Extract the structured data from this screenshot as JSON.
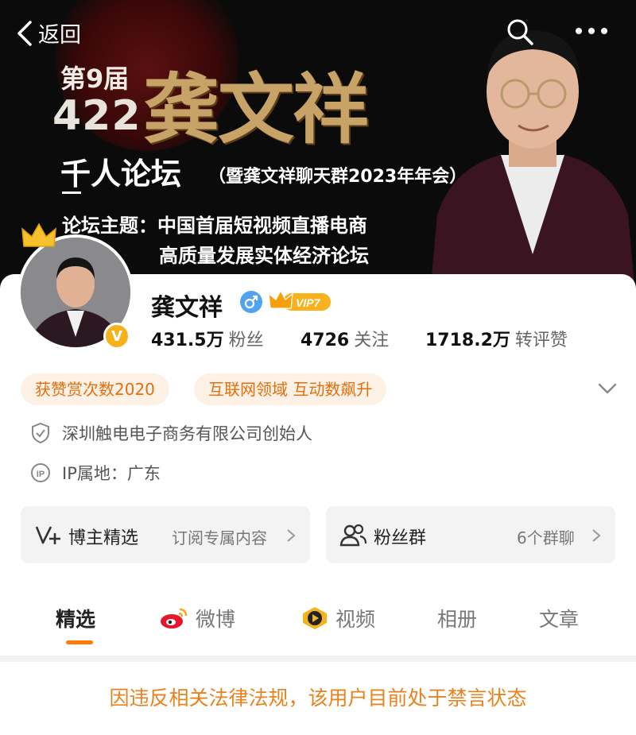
{
  "topbar": {
    "back_label": "返回"
  },
  "banner": {
    "edition": "第9届",
    "number": "422",
    "name": "龚文祥",
    "forum_title": "千人论坛",
    "forum_subtitle": "（暨龚文祥聊天群2023年年会）",
    "theme_line1": "论坛主题：中国首届短视频直播电商",
    "theme_line2": "高质量发展实体经济论坛"
  },
  "profile": {
    "name": "龚文祥",
    "vip_label": "VIP7",
    "verified_mark": "V",
    "stats": [
      {
        "value": "431.5万",
        "label": "粉丝"
      },
      {
        "value": "4726",
        "label": "关注"
      },
      {
        "value": "1718.2万",
        "label": "转评赞"
      }
    ],
    "tags": [
      "获赞赏次数2020",
      "互联网领域 互动数飙升"
    ],
    "company": "深圳触电电子商务有限公司创始人",
    "ip": "IP属地：广东"
  },
  "features": {
    "blogger_pick": {
      "title": "博主精选",
      "sub": "订阅专属内容"
    },
    "fan_group": {
      "title": "粉丝群",
      "sub": "6个群聊"
    }
  },
  "tabs": [
    "精选",
    "微博",
    "视频",
    "相册",
    "文章"
  ],
  "notice": "因违反相关法律法规，该用户目前处于禁言状态",
  "colors": {
    "accent": "#ff7a00",
    "notice": "#e8821d",
    "tag_text": "#e2700f",
    "tag_bg": "#fdf0e4"
  }
}
